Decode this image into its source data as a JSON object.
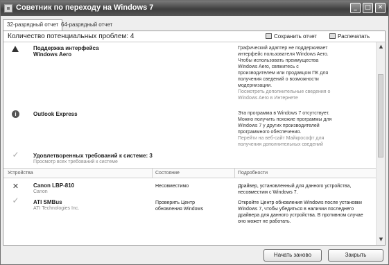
{
  "window": {
    "title": "Советник по переходу на Windows 7",
    "controls": {
      "minimize": "_",
      "maximize": "□",
      "close": "✕"
    }
  },
  "tabs": [
    {
      "label": "32-разрядный отчет",
      "active": true
    },
    {
      "label": "64-разрядный отчет",
      "active": false
    }
  ],
  "header": {
    "issues_count": "Количество потенциальных проблем: 4",
    "save_label": "Сохранить отчет",
    "print_label": "Распечатать"
  },
  "issues": [
    {
      "icon": "warning-icon",
      "name_line1": "Поддержка интерфейса",
      "name_line2": "Windows Aero",
      "desc_lines": [
        "Графический адаптер не поддерживает",
        "интерфейс пользователя Windows Aero.",
        "Чтобы использовать преимущества",
        "Windows Aero, свяжитесь с",
        "производителем или продавцом ПК для",
        "получения сведений о возможности",
        "модернизации."
      ],
      "link_lines": [
        "Посмотреть дополнительные сведения о",
        "Windows Aero в Интернете"
      ]
    },
    {
      "icon": "info-icon",
      "name_line1": "Outlook Express",
      "desc_lines": [
        "Эта программа в Windows 7 отсутствует.",
        "Можно получить похожие программы для",
        "Windows 7 у других производителей",
        "программного обеспечения."
      ],
      "link_lines": [
        "Перейти на веб-сайт Майкрософт для",
        "получения дополнительных сведений"
      ]
    },
    {
      "icon": "checkmark-icon",
      "name_line1": "Удовлетворенных требований к системе: 3",
      "sub": "Просмотр всех требований к системе"
    }
  ],
  "device_columns": [
    "Устройства",
    "Состояние",
    "Подробности"
  ],
  "devices": [
    {
      "icon": "x-mark-icon",
      "name": "Canon LBP-810",
      "manufacturer": "Canon",
      "state": "Несовместимо",
      "details": "Драйвер, установленный для данного устройства, несовместим с Windows 7."
    },
    {
      "icon": "checkmark-icon",
      "name": "ATI SMBus",
      "manufacturer": "ATI Technologies Inc.",
      "state": "Проверить Центр обновления Windows",
      "details": "Откройте Центр обновления Windows после установки Windows 7, чтобы убедиться в наличии последнего драйвера для данного устройства. В противном случае оно может не работать."
    }
  ],
  "footer": {
    "restart_label": "Начать заново",
    "close_label": "Закрыть"
  }
}
